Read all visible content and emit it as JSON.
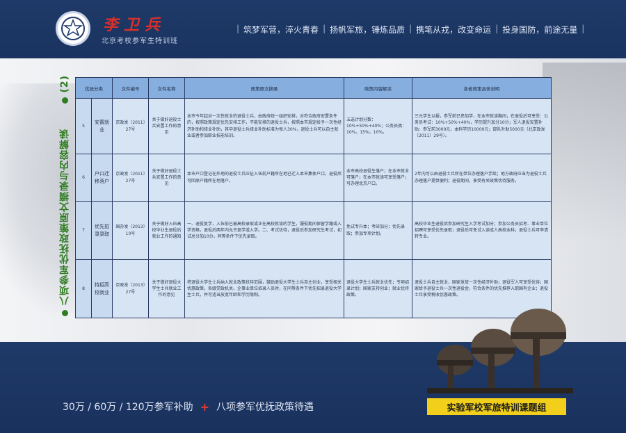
{
  "header": {
    "brand_name": "李卫兵",
    "brand_sub": "北京考校参军生特训班",
    "slogans": [
      "筑梦军营，淬火青春",
      "扬帆军旅，锤炼品质",
      "携笔从戎，改变命运",
      "投身国防，前途无量"
    ]
  },
  "side_title": {
    "text": "八项参军优抚政策原文摘录与内容解读",
    "part": "(2)"
  },
  "table": {
    "headers": [
      "优抚分类",
      "文件编号",
      "文件名称",
      "政策原文摘录",
      "政策内容解读",
      "各省政策具体说明"
    ],
    "rows": [
      {
        "num": "5",
        "category": "安置就业",
        "file_no": "京政发〔2011〕27号",
        "file_name": "关于做好退役士兵安置工作的意见",
        "excerpt": "本市今年起对一次性就业的退役士兵，由政府统一组织安排，对符合政府安置条件的，按照政策规定优先安排工作，不能安排的退役士兵，按照本市规定给予一次性经济补助和择业补助，其中退役士兵择业补助标准为每人30%，退役士兵可以自主就业或者参加职业技能培训。",
        "interpretation": "五选计划分数：10%+50%+40%；公务员类：10%，15%，10%。",
        "details": "三元学生以报，参军前已参加学，在本市就读期间，在退役后可享受：公务员考试：10%+50%+40%，学历提升加分10分；军人退役安置补贴：参军前3000元，本科学历10000元；部队补助5000元（北京政发〔2011〕29号）。"
      },
      {
        "num": "6",
        "category": "户口迁移落户",
        "file_no": "京政发〔2011〕27号",
        "file_name": "关于做好退役士兵安置工作的意见",
        "excerpt": "本市户口登记在外地的退役士兵应征入伍前户籍所在地已迁入本市集体户口，退役后可回原户籍所在地落户。",
        "interpretation": "本市高校退役生落户；在本市就业可落户；在本市就读可享受落户；可办理北京户口。",
        "details": "2年内可以由退役士兵所在单位办理落户手续；地方政府应当为退役士兵办理落户提供便利；退役期间，享受有关政策优待服务。"
      },
      {
        "num": "7",
        "category": "优先招录录取",
        "file_no": "国办发〔2013〕10号",
        "file_name": "关于做好入伍高校毕业生退役后就业工作的通知",
        "excerpt": "一、退役复学，入伍前已被高校录取或正在高校就读的学生，服役期间保留学籍或入学资格，退役后两年内允许复学或入学。二、考试优待，退役后参加研究生考试，初试总分加10分，同等条件下优先录取。",
        "interpretation": "免试专升本；考研加分；优先录取；参加专项计划。",
        "details": "高校毕业生退役后参加研究生入学考试加分；参加公务员招考、事业单位招聘可享受优先录取；退役后可免试入读成人高校本科；退役士兵可申请转专业。"
      },
      {
        "num": "8",
        "category": "特招高校就业",
        "file_no": "京政发〔2013〕27号",
        "file_name": "关于做好退役大学生士兵就业工作的意见",
        "excerpt": "将退役大学生士兵纳入就业政策扶持范围，鼓励退役大学生士兵自主创业，享受相关优惠政策，各级党政机关、企事业单位招录人员时，在同等条件下优先招录退役大学生士兵，并可适当放宽年龄和学历限制。",
        "interpretation": "退役大学生士兵就业优先；专项招录计划；国家支持创业；就业优待政策。",
        "details": "退役士兵自主就业，国家发放一次性经济补助；退役军人可享受优待；国家给予退役士兵一次性退役金，符合条件的优先推荐入职国有企业；退役士兵享受税收优惠政策。"
      }
    ]
  },
  "footer": {
    "subsidy_text": "30万 / 60万 / 120万参军补助",
    "plus": "+",
    "policy_text": "八项参军优抚政策待遇",
    "badge": "实验军校军旅特训课题组"
  }
}
